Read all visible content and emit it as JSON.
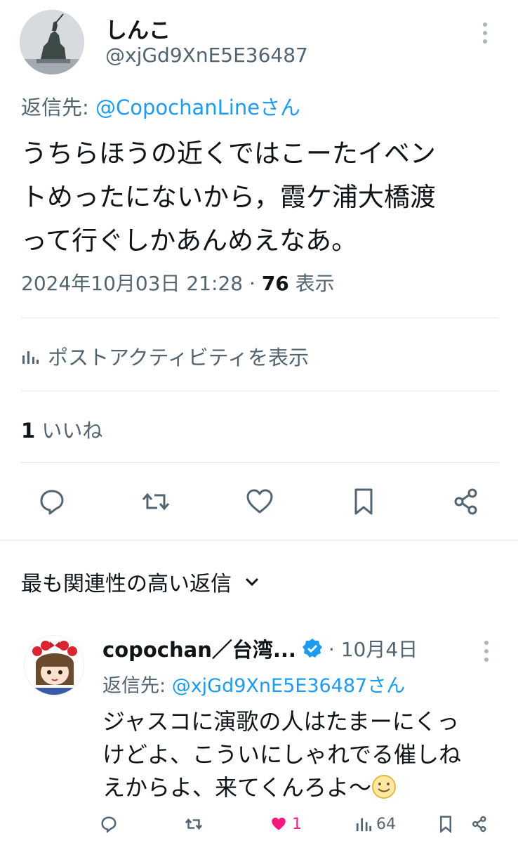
{
  "post": {
    "display_name": "しんこ",
    "handle": "@xjGd9XnE5E36487",
    "reply_to_label": "返信先: ",
    "reply_to_user": "@CopochanLineさん",
    "text_lines": [
      "うちらほうの近くではこーたイベン",
      "トめったにないから，霞ケ浦大橋渡",
      "って行ぐしかあんめえなあ。"
    ],
    "timestamp": "2024年10月03日 21:28 · ",
    "view_count": "76",
    "view_label": " 表示",
    "activity_label": "ポストアクティビティを表示",
    "like_count": "1",
    "like_label": " いいね"
  },
  "sort": {
    "label": "最も関連性の高い返信"
  },
  "reply": {
    "display_name": "copochan／台湾...",
    "date": "· 10月4日",
    "reply_to_label": "返信先: ",
    "reply_to_user": "@xjGd9XnE5E36487さん",
    "text_lines": [
      "ジャスコに演歌の人はたまーにくっ",
      "けどよ、こういにしゃれでる催しね",
      "えからよ、来てくんろよ〜"
    ],
    "like_count": "1",
    "view_count": "64"
  },
  "icons": [
    "reply-icon",
    "repost-icon",
    "like-icon",
    "bookmark-icon",
    "share-icon",
    "analytics-icon",
    "chevron-down-icon",
    "verified-icon",
    "more-icon",
    "smile-emoji"
  ],
  "colors": {
    "link": "#1d9bf0",
    "secondary_text": "#536471",
    "like_pink": "#f91880"
  }
}
